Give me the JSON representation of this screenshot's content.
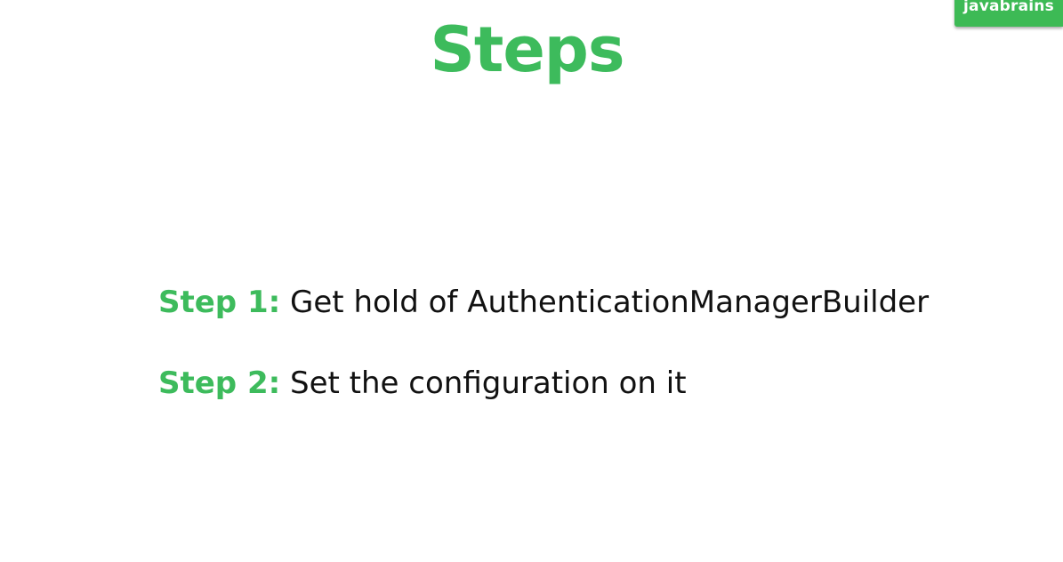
{
  "slide": {
    "title": "Steps",
    "brand": "javabrains",
    "steps": [
      {
        "label": "Step 1:",
        "text": " Get hold of AuthenticationManagerBuilder"
      },
      {
        "label": "Step 2:",
        "text": " Set the configuration on it"
      }
    ]
  },
  "colors": {
    "accent": "#3dbb5c",
    "text": "#111111",
    "background": "#ffffff"
  }
}
